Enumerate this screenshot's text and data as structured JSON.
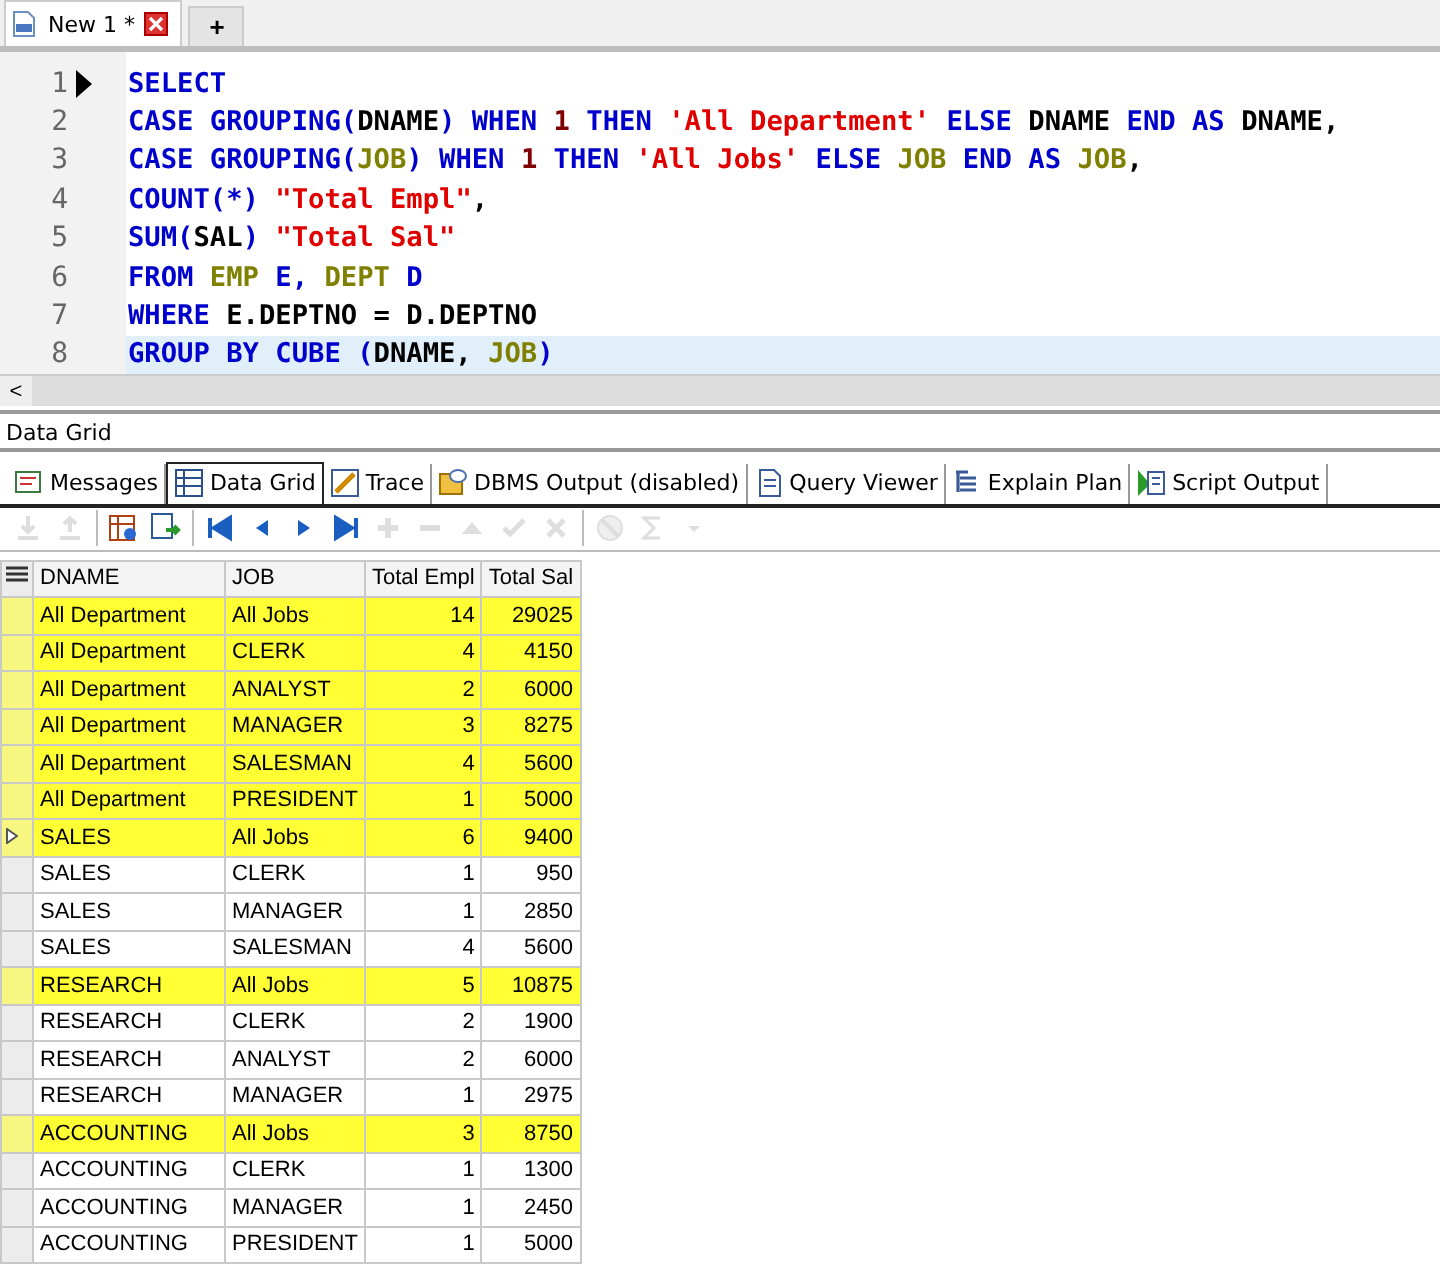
{
  "editor_tabs": [
    {
      "label": "New 1 *",
      "selected": true,
      "kind": "document"
    },
    {
      "label": "+",
      "selected": false,
      "kind": "add"
    }
  ],
  "editor": {
    "lines": [
      {
        "number": "1",
        "executing": true,
        "current": false,
        "tokens": [
          {
            "t": "SELECT",
            "kind": "kw"
          }
        ]
      },
      {
        "number": "2",
        "executing": false,
        "current": false,
        "tokens": [
          {
            "t": "CASE GROUPING(",
            "kind": "kw"
          },
          {
            "t": "DNAME",
            "kind": "plain"
          },
          {
            "t": ") WHEN ",
            "kind": "kw"
          },
          {
            "t": "1",
            "kind": "num"
          },
          {
            "t": " THEN ",
            "kind": "kw"
          },
          {
            "t": "'All Department'",
            "kind": "str"
          },
          {
            "t": " ELSE ",
            "kind": "kw"
          },
          {
            "t": "DNAME",
            "kind": "plain"
          },
          {
            "t": " END AS ",
            "kind": "kw"
          },
          {
            "t": "DNAME,",
            "kind": "plain"
          }
        ]
      },
      {
        "number": "3",
        "executing": false,
        "current": false,
        "tokens": [
          {
            "t": "CASE GROUPING(",
            "kind": "kw"
          },
          {
            "t": "JOB",
            "kind": "obj"
          },
          {
            "t": ") WHEN ",
            "kind": "kw"
          },
          {
            "t": "1",
            "kind": "num"
          },
          {
            "t": " THEN ",
            "kind": "kw"
          },
          {
            "t": "'All Jobs'",
            "kind": "str"
          },
          {
            "t": " ELSE ",
            "kind": "kw"
          },
          {
            "t": "JOB",
            "kind": "obj"
          },
          {
            "t": " END AS ",
            "kind": "kw"
          },
          {
            "t": "JOB",
            "kind": "obj"
          },
          {
            "t": ",",
            "kind": "plain"
          }
        ]
      },
      {
        "number": "4",
        "executing": false,
        "current": false,
        "tokens": [
          {
            "t": "COUNT(*) ",
            "kind": "kw"
          },
          {
            "t": "\"Total Empl\"",
            "kind": "str"
          },
          {
            "t": ",",
            "kind": "plain"
          }
        ]
      },
      {
        "number": "5",
        "executing": false,
        "current": false,
        "tokens": [
          {
            "t": "SUM(",
            "kind": "kw"
          },
          {
            "t": "SAL",
            "kind": "plain"
          },
          {
            "t": ") ",
            "kind": "kw"
          },
          {
            "t": "\"Total Sal\"",
            "kind": "str"
          }
        ]
      },
      {
        "number": "6",
        "executing": false,
        "current": false,
        "tokens": [
          {
            "t": "FROM ",
            "kind": "kw"
          },
          {
            "t": "EMP",
            "kind": "obj"
          },
          {
            "t": " E, ",
            "kind": "kw"
          },
          {
            "t": "DEPT",
            "kind": "obj"
          },
          {
            "t": " D",
            "kind": "kw"
          }
        ]
      },
      {
        "number": "7",
        "executing": false,
        "current": false,
        "tokens": [
          {
            "t": "WHERE ",
            "kind": "kw"
          },
          {
            "t": "E.DEPTNO = D.DEPTNO",
            "kind": "plain"
          }
        ]
      },
      {
        "number": "8",
        "executing": false,
        "current": true,
        "tokens": [
          {
            "t": "GROUP BY CUBE (",
            "kind": "kw"
          },
          {
            "t": "DNAME, ",
            "kind": "plain"
          },
          {
            "t": "JOB",
            "kind": "obj"
          },
          {
            "t": ")",
            "kind": "kw"
          }
        ]
      }
    ]
  },
  "scroll_left": "<",
  "panel_title": "Data Grid",
  "result_tabs": [
    {
      "label": "Messages",
      "kind": "messages",
      "selected": false
    },
    {
      "label": "Data Grid",
      "kind": "grid",
      "selected": true
    },
    {
      "label": "Trace",
      "kind": "trace",
      "selected": false
    },
    {
      "label": "DBMS Output (disabled)",
      "kind": "dbms",
      "selected": false
    },
    {
      "label": "Query Viewer",
      "kind": "viewer",
      "selected": false
    },
    {
      "label": "Explain Plan",
      "kind": "plan",
      "selected": false
    },
    {
      "label": "Script Output",
      "kind": "script",
      "selected": false
    }
  ],
  "toolbar": [
    {
      "kind": "download",
      "disabled": true
    },
    {
      "kind": "upload",
      "disabled": true
    },
    {
      "kind": "sep"
    },
    {
      "kind": "grid-settings",
      "disabled": false
    },
    {
      "kind": "grid-export",
      "disabled": false
    },
    {
      "kind": "sep"
    },
    {
      "kind": "first",
      "disabled": false
    },
    {
      "kind": "prev",
      "disabled": false
    },
    {
      "kind": "next",
      "disabled": false
    },
    {
      "kind": "last",
      "disabled": false
    },
    {
      "kind": "plus",
      "disabled": true
    },
    {
      "kind": "minus",
      "disabled": true
    },
    {
      "kind": "up",
      "disabled": true
    },
    {
      "kind": "check",
      "disabled": true
    },
    {
      "kind": "cross",
      "disabled": true
    },
    {
      "kind": "sep"
    },
    {
      "kind": "filter",
      "disabled": true
    },
    {
      "kind": "sigma",
      "disabled": true
    },
    {
      "kind": "caret",
      "disabled": true
    }
  ],
  "table": {
    "columns": [
      "DNAME",
      "JOB",
      "Total Empl",
      "Total Sal"
    ],
    "rows": [
      {
        "cells": [
          "All Department",
          "All Jobs",
          "14",
          "29025"
        ],
        "highlighted": true,
        "current": false
      },
      {
        "cells": [
          "All Department",
          "CLERK",
          "4",
          "4150"
        ],
        "highlighted": true,
        "current": false
      },
      {
        "cells": [
          "All Department",
          "ANALYST",
          "2",
          "6000"
        ],
        "highlighted": true,
        "current": false
      },
      {
        "cells": [
          "All Department",
          "MANAGER",
          "3",
          "8275"
        ],
        "highlighted": true,
        "current": false
      },
      {
        "cells": [
          "All Department",
          "SALESMAN",
          "4",
          "5600"
        ],
        "highlighted": true,
        "current": false
      },
      {
        "cells": [
          "All Department",
          "PRESIDENT",
          "1",
          "5000"
        ],
        "highlighted": true,
        "current": false
      },
      {
        "cells": [
          "SALES",
          "All Jobs",
          "6",
          "9400"
        ],
        "highlighted": true,
        "current": true
      },
      {
        "cells": [
          "SALES",
          "CLERK",
          "1",
          "950"
        ],
        "highlighted": false,
        "current": false
      },
      {
        "cells": [
          "SALES",
          "MANAGER",
          "1",
          "2850"
        ],
        "highlighted": false,
        "current": false
      },
      {
        "cells": [
          "SALES",
          "SALESMAN",
          "4",
          "5600"
        ],
        "highlighted": false,
        "current": false
      },
      {
        "cells": [
          "RESEARCH",
          "All Jobs",
          "5",
          "10875"
        ],
        "highlighted": true,
        "current": false
      },
      {
        "cells": [
          "RESEARCH",
          "CLERK",
          "2",
          "1900"
        ],
        "highlighted": false,
        "current": false
      },
      {
        "cells": [
          "RESEARCH",
          "ANALYST",
          "2",
          "6000"
        ],
        "highlighted": false,
        "current": false
      },
      {
        "cells": [
          "RESEARCH",
          "MANAGER",
          "1",
          "2975"
        ],
        "highlighted": false,
        "current": false
      },
      {
        "cells": [
          "ACCOUNTING",
          "All Jobs",
          "3",
          "8750"
        ],
        "highlighted": true,
        "current": false
      },
      {
        "cells": [
          "ACCOUNTING",
          "CLERK",
          "1",
          "1300"
        ],
        "highlighted": false,
        "current": false
      },
      {
        "cells": [
          "ACCOUNTING",
          "MANAGER",
          "1",
          "2450"
        ],
        "highlighted": false,
        "current": false
      },
      {
        "cells": [
          "ACCOUNTING",
          "PRESIDENT",
          "1",
          "5000"
        ],
        "highlighted": false,
        "current": false
      }
    ]
  }
}
